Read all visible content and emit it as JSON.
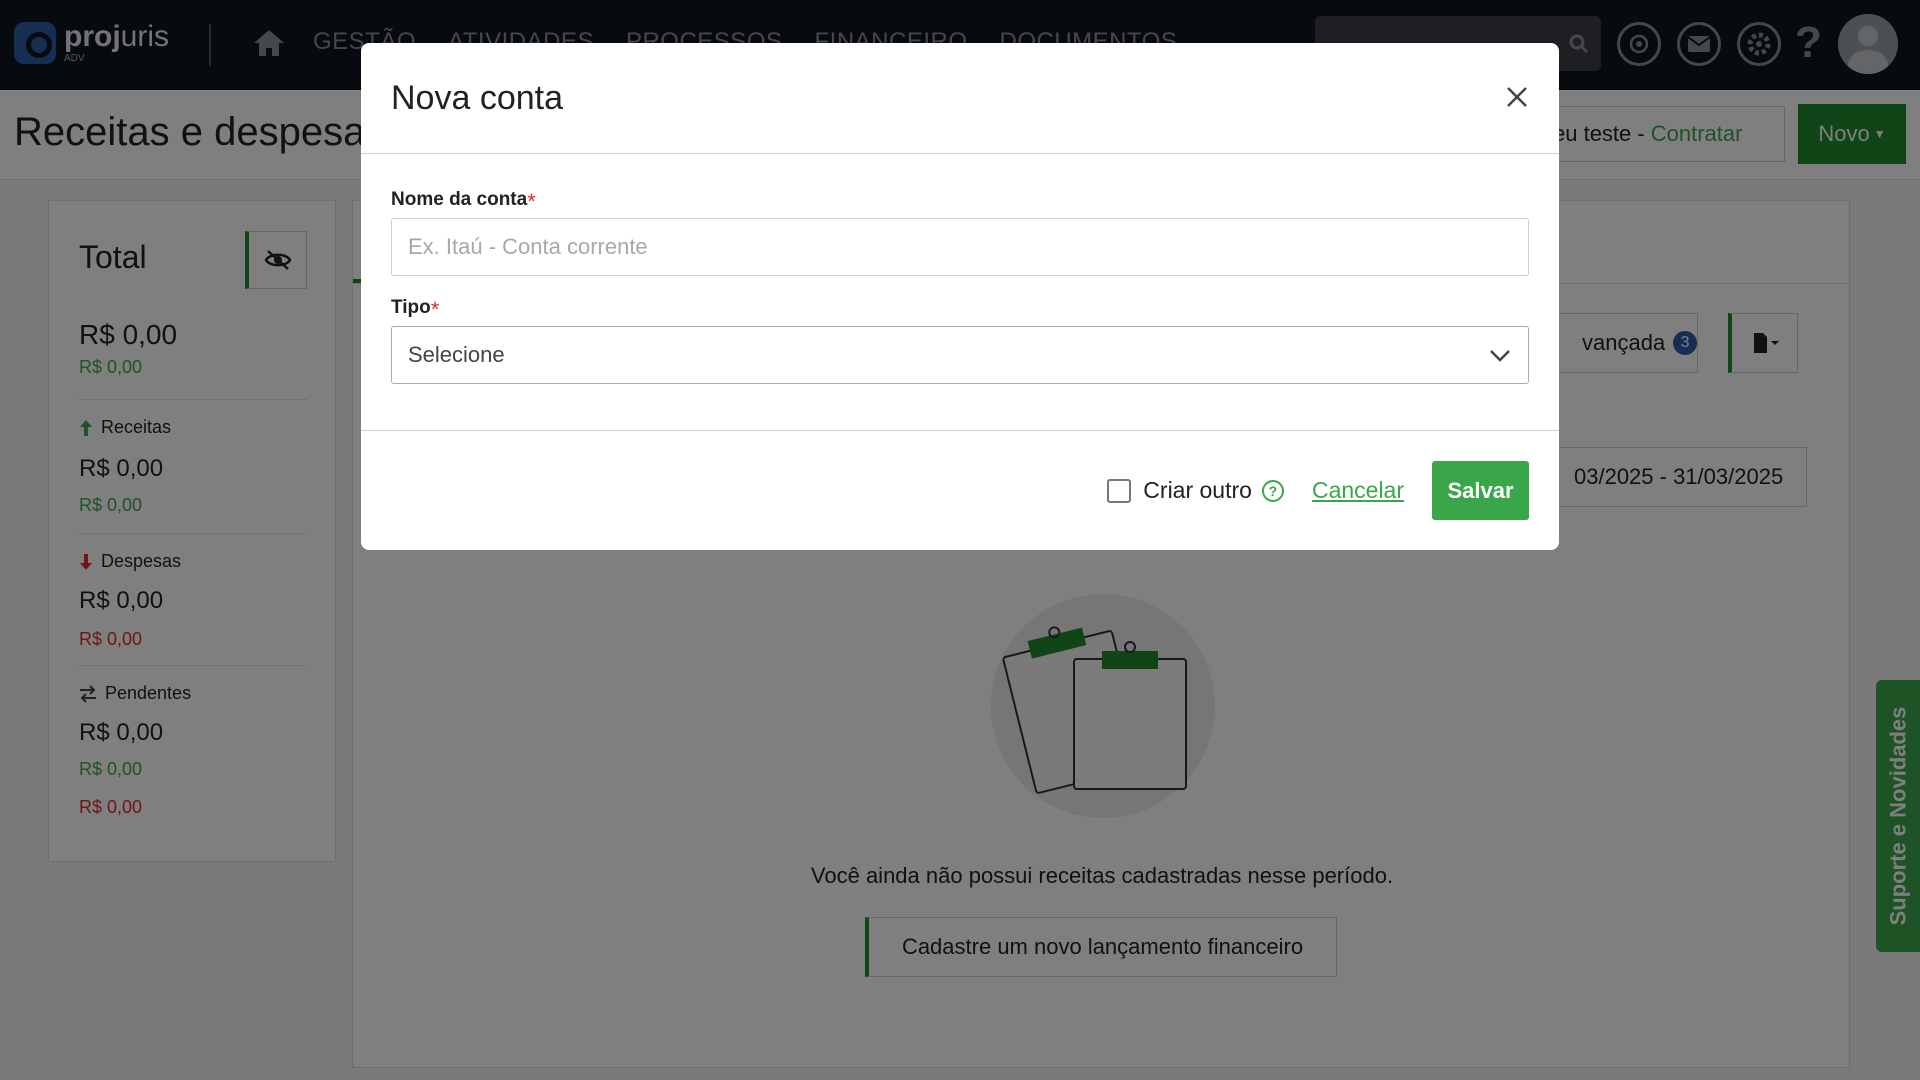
{
  "app": {
    "logo_name_bold": "proj",
    "logo_name_light": "uris",
    "logo_sub": "ADV"
  },
  "nav": {
    "items": [
      "GESTÃO",
      "ATIVIDADES",
      "PROCESSOS",
      "FINANCEIRO",
      "DOCUMENTOS"
    ]
  },
  "header": {
    "title": "Receitas e despesas",
    "trial_text": "eu teste -",
    "trial_link": "Contratar",
    "new_button": "Novo"
  },
  "summary": {
    "total_title": "Total",
    "total_value": "R$ 0,00",
    "total_sub": "R$ 0,00",
    "receitas_label": "Receitas",
    "receitas_value": "R$ 0,00",
    "receitas_sub": "R$ 0,00",
    "despesas_label": "Despesas",
    "despesas_value": "R$ 0,00",
    "despesas_sub": "R$ 0,00",
    "pendentes_label": "Pendentes",
    "pendentes_value": "R$ 0,00",
    "pendentes_green": "R$ 0,00",
    "pendentes_red": "R$ 0,00"
  },
  "main": {
    "advanced_search": "vançada",
    "advanced_badge": "3",
    "date_range": "03/2025 - 31/03/2025",
    "empty_text": "Você ainda não possui receitas cadastradas nesse período.",
    "cadastre_button": "Cadastre um novo lançamento financeiro"
  },
  "suporte": "Suporte e Novidades",
  "modal": {
    "title": "Nova conta",
    "field_name_label": "Nome da conta",
    "field_name_placeholder": "Ex. Itaú - Conta corrente",
    "field_name_value": "",
    "field_type_label": "Tipo",
    "field_type_value": "Selecione",
    "required_mark": "*",
    "checkbox_label": "Criar outro",
    "help_mark": "?",
    "cancel": "Cancelar",
    "save": "Salvar"
  },
  "colors": {
    "accent_green": "#3aa64a",
    "dark_green": "#1f8a2e",
    "negative_red": "#d9302c",
    "topbar": "#0f1620"
  },
  "icons": [
    "home-icon",
    "search-icon",
    "openai-icon",
    "mail-icon",
    "gear-icon",
    "help-icon",
    "avatar",
    "eye-slash-icon",
    "arrow-up-icon",
    "arrow-down-icon",
    "swap-icon",
    "document-icon",
    "close-icon",
    "chevron-down-icon",
    "question-circle-icon"
  ]
}
